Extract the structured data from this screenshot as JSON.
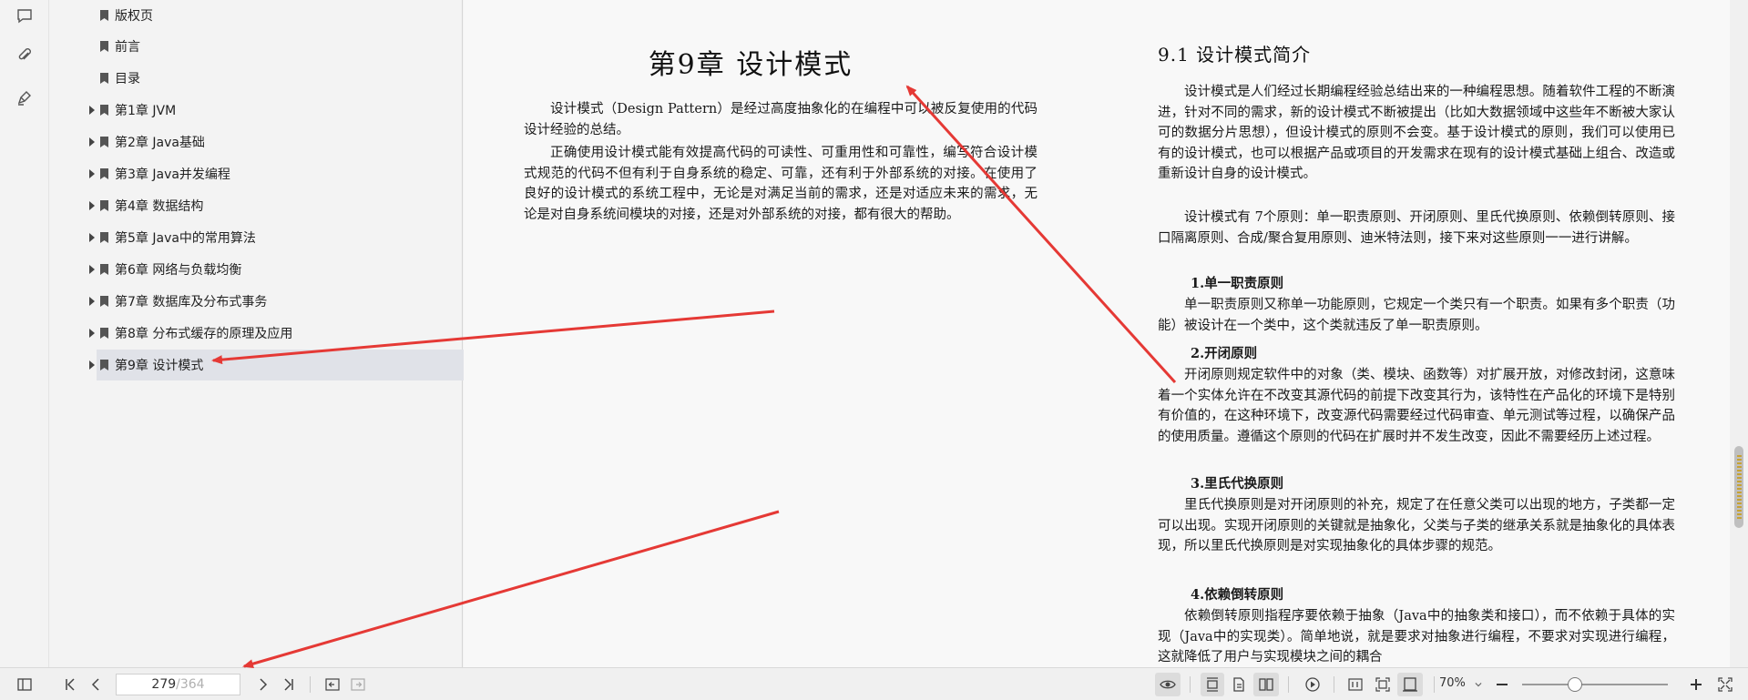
{
  "outline": {
    "items": [
      {
        "label": "版权页",
        "has_children": false
      },
      {
        "label": "前言",
        "has_children": false
      },
      {
        "label": "目录",
        "has_children": false
      },
      {
        "label": "第1章 JVM",
        "has_children": true
      },
      {
        "label": "第2章 Java基础",
        "has_children": true
      },
      {
        "label": "第3章 Java并发编程",
        "has_children": true
      },
      {
        "label": "第4章 数据结构",
        "has_children": true
      },
      {
        "label": "第5章 Java中的常用算法",
        "has_children": true
      },
      {
        "label": "第6章 网络与负载均衡",
        "has_children": true
      },
      {
        "label": "第7章 数据库及分布式事务",
        "has_children": true
      },
      {
        "label": "第8章 分布式缓存的原理及应用",
        "has_children": true
      },
      {
        "label": "第9章 设计模式",
        "has_children": true,
        "selected": true
      }
    ]
  },
  "left_page": {
    "chapter_title": "第9章  设计模式",
    "paragraphs": [
      "设计模式（Design Pattern）是经过高度抽象化的在编程中可以被反复使用的代码设计经验的总结。",
      "正确使用设计模式能有效提高代码的可读性、可重用性和可靠性，编写符合设计模式规范的代码不但有利于自身系统的稳定、可靠，还有利于外部系统的对接。在使用了良好的设计模式的系统工程中，无论是对满足当前的需求，还是对适应未来的需求，无论是对自身系统间模块的对接，还是对外部系统的对接，都有很大的帮助。"
    ]
  },
  "right_page": {
    "section_title": "9.1  设计模式简介",
    "intro": [
      "设计模式是人们经过长期编程经验总结出来的一种编程思想。随着软件工程的不断演进，针对不同的需求，新的设计模式不断被提出（比如大数据领域中这些年不断被大家认可的数据分片思想），但设计模式的原则不会变。基于设计模式的原则，我们可以使用已有的设计模式，也可以根据产品或项目的开发需求在现有的设计模式基础上组合、改造或重新设计自身的设计模式。",
      "设计模式有 7个原则：单一职责原则、开闭原则、里氏代换原则、依赖倒转原则、接口隔离原则、合成/聚合复用原则、迪米特法则，接下来对这些原则一一进行讲解。"
    ],
    "principles": [
      {
        "title": "1.单一职责原则",
        "text": "单一职责原则又称单一功能原则，它规定一个类只有一个职责。如果有多个职责（功能）被设计在一个类中，这个类就违反了单一职责原则。"
      },
      {
        "title": "2.开闭原则",
        "text": "开闭原则规定软件中的对象（类、模块、函数等）对扩展开放，对修改封闭，这意味着一个实体允许在不改变其源代码的前提下改变其行为，该特性在产品化的环境下是特别有价值的，在这种环境下，改变源代码需要经过代码审查、单元测试等过程，以确保产品的使用质量。遵循这个原则的代码在扩展时并不发生改变，因此不需要经历上述过程。"
      },
      {
        "title": "3.里氏代换原则",
        "text": "里氏代换原则是对开闭原则的补充，规定了在任意父类可以出现的地方，子类都一定可以出现。实现开闭原则的关键就是抽象化，父类与子类的继承关系就是抽象化的具体表现，所以里氏代换原则是对实现抽象化的具体步骤的规范。"
      },
      {
        "title": "4.依赖倒转原则",
        "text": "依赖倒转原则指程序要依赖于抽象（Java中的抽象类和接口），而不依赖于具体的实现（Java中的实现类）。简单地说，就是要求对抽象进行编程，不要求对实现进行编程，这就降低了用户与实现模块之间的耦合"
      }
    ]
  },
  "toolbar": {
    "current_page": "279",
    "total_pages": "/364",
    "zoom": "70%",
    "zoom_level": 0.7
  },
  "colors": {
    "annotation_arrow": "#e53935",
    "selected_item_bg": "#e0e2e8"
  }
}
